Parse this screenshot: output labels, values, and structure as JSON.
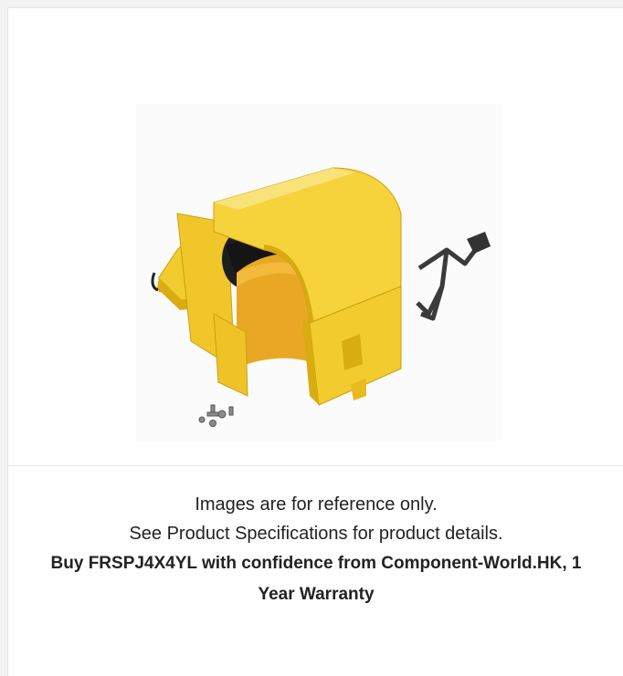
{
  "product": {
    "image_alt": "FRSPJ4X4YL yellow fiber raceway spill-over junction with bracket and hardware",
    "colors": {
      "yellow": "#f2cc2e",
      "yellow_dark": "#d9ad12",
      "yellow_light": "#f8df6a",
      "black_part": "#1e1e1e",
      "bracket": "#3b3b3b"
    }
  },
  "caption": {
    "line1": "Images are for reference only.",
    "line2": "See Product Specifications for product details.",
    "line3": "Buy FRSPJ4X4YL with confidence from Component-World.HK, 1 Year Warranty"
  }
}
